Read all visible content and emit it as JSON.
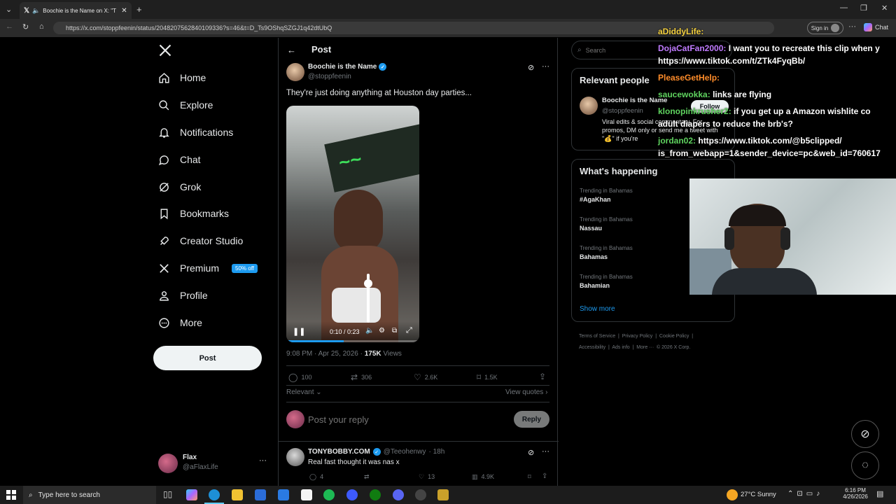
{
  "browser": {
    "tab_title": "Boochie is the Name on X: \"T",
    "url": "https://x.com/stoppfeenin/status/2048207562840109336?s=46&t=D_Ts9OShqSZGJ1q42dtUbQ",
    "sign_in": "Sign in",
    "chat": "Chat"
  },
  "nav": {
    "items": [
      {
        "label": "Home",
        "icon": "home-icon"
      },
      {
        "label": "Explore",
        "icon": "search-icon"
      },
      {
        "label": "Notifications",
        "icon": "bell-icon"
      },
      {
        "label": "Chat",
        "icon": "chat-bubble-icon"
      },
      {
        "label": "Grok",
        "icon": "grok-icon"
      },
      {
        "label": "Bookmarks",
        "icon": "bookmark-icon"
      },
      {
        "label": "Creator Studio",
        "icon": "rocket-icon"
      },
      {
        "label": "Premium",
        "icon": "x-logo-icon"
      },
      {
        "label": "Profile",
        "icon": "person-icon"
      },
      {
        "label": "More",
        "icon": "more-circle-icon"
      }
    ],
    "premium_badge": "50% off",
    "post_button": "Post",
    "account_name": "Flax",
    "account_handle": "@aFlaxLife"
  },
  "post": {
    "header": "Post",
    "author_name": "Boochie is the Name",
    "author_handle": "@stoppfeenin",
    "text": "They're just doing anything at Houston day parties...",
    "video_time": "0:10 / 0:23",
    "video_progress": 0.43,
    "timestamp": "9:08 PM · Apr 25, 2026 · ",
    "views_count": "175K",
    "views_label": " Views",
    "stats": {
      "replies": "100",
      "reposts": "306",
      "likes": "2.6K",
      "bookmarks": "1.5K"
    },
    "sort": "Relevant",
    "view_quotes": "View quotes",
    "reply_placeholder": "Post your reply",
    "reply_button": "Reply"
  },
  "reply": {
    "name": "TONYBOBBY.COM",
    "handle": "@Teeohenwy",
    "age": "· 18h",
    "text": "Real fast thought it was nas x",
    "stats": {
      "replies": "4",
      "reposts": "",
      "likes": "13",
      "views": "4.9K"
    }
  },
  "sidebar": {
    "search_placeholder": "Search",
    "relevant_title": "Relevant people",
    "person_name": "Boochie is the Name",
    "person_handle": "@stoppfeenin",
    "follow": "Follow",
    "bio": "Viral edits & social commentary. For promos, DM only or send me a tweet with \"💰\" if you're",
    "happening_title": "What's happening",
    "trends": [
      {
        "context": "Trending in Bahamas",
        "name": "#AgaKhan"
      },
      {
        "context": "Trending in Bahamas",
        "name": "Nassau"
      },
      {
        "context": "Trending in Bahamas",
        "name": "Bahamas"
      },
      {
        "context": "Trending in Bahamas",
        "name": "Bahamian"
      }
    ],
    "show_more": "Show more",
    "footer": [
      "Terms of Service",
      "|",
      "Privacy Policy",
      "|",
      "Cookie Policy",
      "|",
      "Accessibility",
      "|",
      "Ads info",
      "|",
      "More ···",
      "© 2026 X Corp."
    ]
  },
  "stream_chat": [
    {
      "user": "aDiddyLife:",
      "color": "#f4d03f",
      "msg": ""
    },
    {
      "user": "DojaCatFan2000:",
      "color": "#c07bff",
      "msg": "I want you to recreate this clip when y"
    },
    {
      "user": "",
      "color": "#ffffff",
      "msg": "https://www.tiktok.com/t/ZTk4FyqBb/"
    },
    {
      "user": "PleaseGetHelp:",
      "color": "#ff8c2a",
      "msg": ""
    },
    {
      "user": "saucewokka:",
      "color": "#5fd35f",
      "msg": "links are flying"
    },
    {
      "user": "klonopinkrusher2:",
      "color": "#5fd35f",
      "msg": "if you get up a Amazon wishlite co"
    },
    {
      "user": "",
      "color": "#ffffff",
      "msg": "adult diapers to reduce the brb's?"
    },
    {
      "user": "jordan02:",
      "color": "#5fd35f",
      "msg": "https://www.tiktok.com/@b5clipped/"
    },
    {
      "user": "",
      "color": "#ffffff",
      "msg": "is_from_webapp=1&sender_device=pc&web_id=760617"
    }
  ],
  "taskbar": {
    "search_placeholder": "Type here to search",
    "weather": "27°C  Sunny",
    "time": "6:16 PM",
    "date": "4/26/2026"
  },
  "colors": {
    "accent": "#1d9bf0",
    "background": "#000000",
    "border": "#2f3336",
    "muted": "#71767b"
  }
}
